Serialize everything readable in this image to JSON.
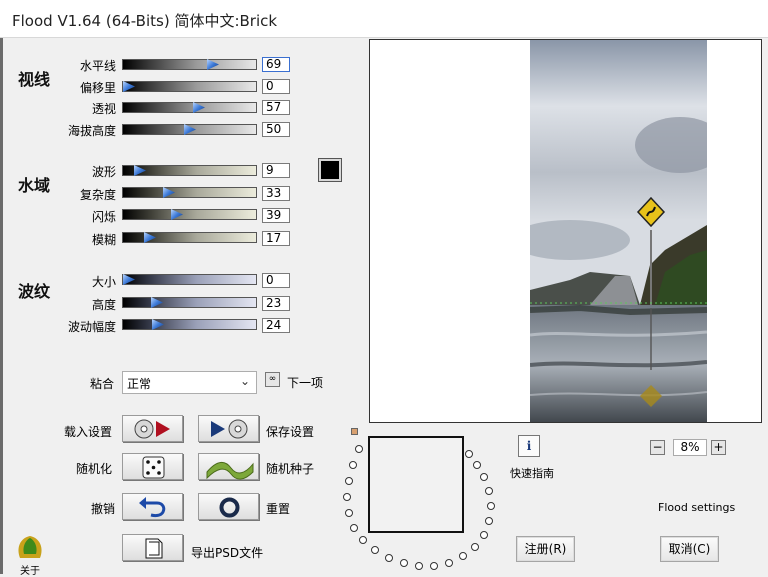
{
  "window": {
    "title": "Flood V1.64 (64-Bits)  简体中文:Brick"
  },
  "sections": {
    "view": "视线",
    "water": "水域",
    "ripple": "波纹"
  },
  "view_rows": [
    {
      "label": "水平线",
      "value": "69",
      "fraction": 0.69
    },
    {
      "label": "偏移里",
      "value": "0",
      "fraction": 0.0
    },
    {
      "label": "透视",
      "value": "57",
      "fraction": 0.57
    },
    {
      "label": "海拔高度",
      "value": "50",
      "fraction": 0.5
    }
  ],
  "water_rows": [
    {
      "label": "波形",
      "value": "9",
      "fraction": 0.09
    },
    {
      "label": "复杂度",
      "value": "33",
      "fraction": 0.33
    },
    {
      "label": "闪烁",
      "value": "39",
      "fraction": 0.39
    },
    {
      "label": "模糊",
      "value": "17",
      "fraction": 0.17
    }
  ],
  "ripple_rows": [
    {
      "label": "大小",
      "value": "0",
      "fraction": 0.0
    },
    {
      "label": "高度",
      "value": "23",
      "fraction": 0.23
    },
    {
      "label": "波动幅度",
      "value": "24",
      "fraction": 0.24
    }
  ],
  "blend": {
    "label": "粘合",
    "selected": "正常",
    "next_label": "下一项"
  },
  "actions": {
    "load": "载入设置",
    "save": "保存设置",
    "randomize": "随机化",
    "random_seed": "随机种子",
    "undo": "撤销",
    "reset": "重置",
    "export_psd": "导出PSD文件",
    "about": "关于"
  },
  "quick_guide": "快速指南",
  "zoom": {
    "value": "8%",
    "minus": "−",
    "plus": "+"
  },
  "settings_caption": "Flood settings",
  "buttons": {
    "register": "注册(R)",
    "cancel": "取消(C)"
  },
  "colors": {
    "swatch": "#000000",
    "accent": "#3c7ad8"
  }
}
